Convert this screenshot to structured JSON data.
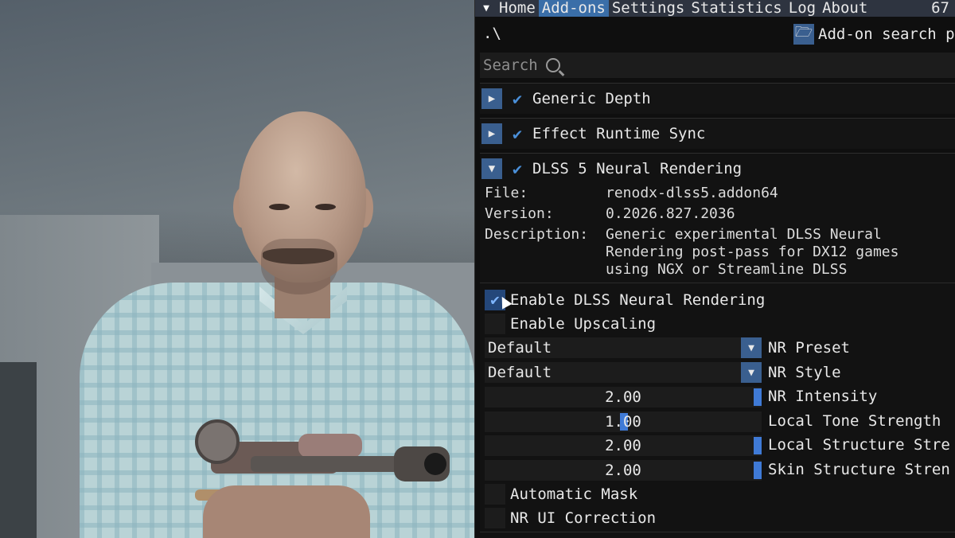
{
  "menu": {
    "items": [
      "Home",
      "Add-ons",
      "Settings",
      "Statistics",
      "Log",
      "About"
    ],
    "active_index": 1,
    "fps": "67"
  },
  "path": ".\\",
  "addon_search_label": "Add-on search p",
  "search": {
    "placeholder": "Search"
  },
  "addons": [
    {
      "name": "Generic Depth",
      "expanded": false,
      "enabled": true
    },
    {
      "name": "Effect Runtime Sync",
      "expanded": false,
      "enabled": true
    },
    {
      "name": "DLSS 5 Neural Rendering",
      "expanded": true,
      "enabled": true
    }
  ],
  "details": {
    "file_key": "File:",
    "file_value": "renodx-dlss5.addon64",
    "version_key": "Version:",
    "version_value": "0.2026.827.2036",
    "description_key": "Description:",
    "description_lines": [
      "Generic experimental DLSS Neural",
      "Rendering post-pass for DX12 games",
      "using NGX or Streamline DLSS"
    ]
  },
  "options": {
    "enable_nr": {
      "label": "Enable DLSS Neural Rendering",
      "checked": true
    },
    "enable_upscaling": {
      "label": "Enable Upscaling",
      "checked": false
    },
    "nr_preset": {
      "value": "Default",
      "label": "NR Preset"
    },
    "nr_style": {
      "value": "Default",
      "label": "NR Style"
    },
    "nr_intensity": {
      "value": "2.00",
      "label": "NR Intensity"
    },
    "local_tone": {
      "value": "1.00",
      "label": "Local Tone Strength"
    },
    "local_structure": {
      "value": "2.00",
      "label": "Local Structure Stre"
    },
    "skin_structure": {
      "value": "2.00",
      "label": "Skin Structure Stren"
    },
    "automatic_mask": {
      "label": "Automatic Mask",
      "checked": false
    },
    "nr_ui_correction": {
      "label": "NR UI Correction",
      "checked": false
    }
  },
  "colors": {
    "accent": "#3a6ea8",
    "button": "#3a5f8f",
    "check": "#4a8fd8",
    "panel_bg": "#0f0f0f"
  },
  "icons": [
    "menu-triangle-icon",
    "folder-icon",
    "search-icon",
    "expand-arrow-icon",
    "checkmark-icon",
    "dropdown-arrow-icon",
    "mouse-cursor-icon"
  ]
}
